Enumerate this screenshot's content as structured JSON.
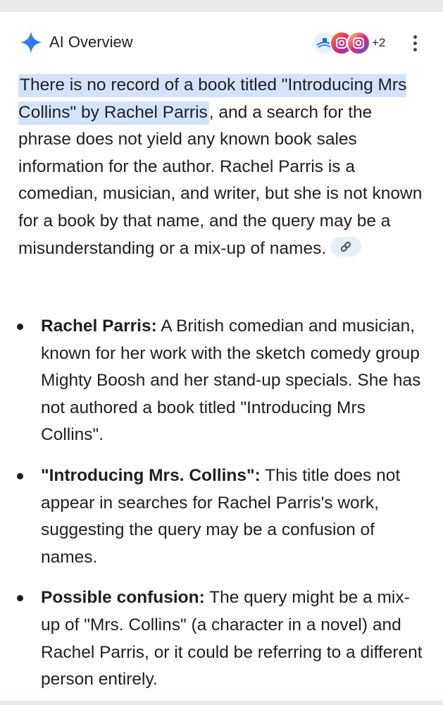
{
  "header": {
    "title": "AI Overview",
    "sources_extra_count": "+2",
    "sparkle_icon": "gemini-sparkle-icon",
    "sparkle_color": "#1a73e8",
    "sources": [
      "source-1-icon",
      "source-2-icon",
      "source-3-icon"
    ],
    "more_icon": "more-vert-icon"
  },
  "answer": {
    "highlighted": "There is no record of a book titled \"Introducing Mrs Collins\" by Rachel Parris",
    "rest": ", and a search for the phrase does not yield any known book sales information for the author. Rachel Parris is a comedian, musician, and writer, but she is not known for a book by that name, and the query may be a misunderstanding or a mix-up of names.",
    "highlight_color": "#d3e3fd",
    "link_icon": "link-icon"
  },
  "bullets": [
    {
      "label": "Rachel Parris:",
      "text": " A British comedian and musician, known for her work with the sketch comedy group Mighty Boosh and her stand-up specials. She has not authored a book titled \"Introducing Mrs Collins\"."
    },
    {
      "label": "\"Introducing Mrs. Collins\":",
      "text": " This title does not appear in searches for Rachel Parris's work, suggesting the query may be a confusion of names."
    },
    {
      "label": "Possible confusion:",
      "text": " The query might be a mix-up of \"Mrs. Collins\" (a character in a novel) and Rachel Parris, or it could be referring to a different person entirely."
    }
  ]
}
